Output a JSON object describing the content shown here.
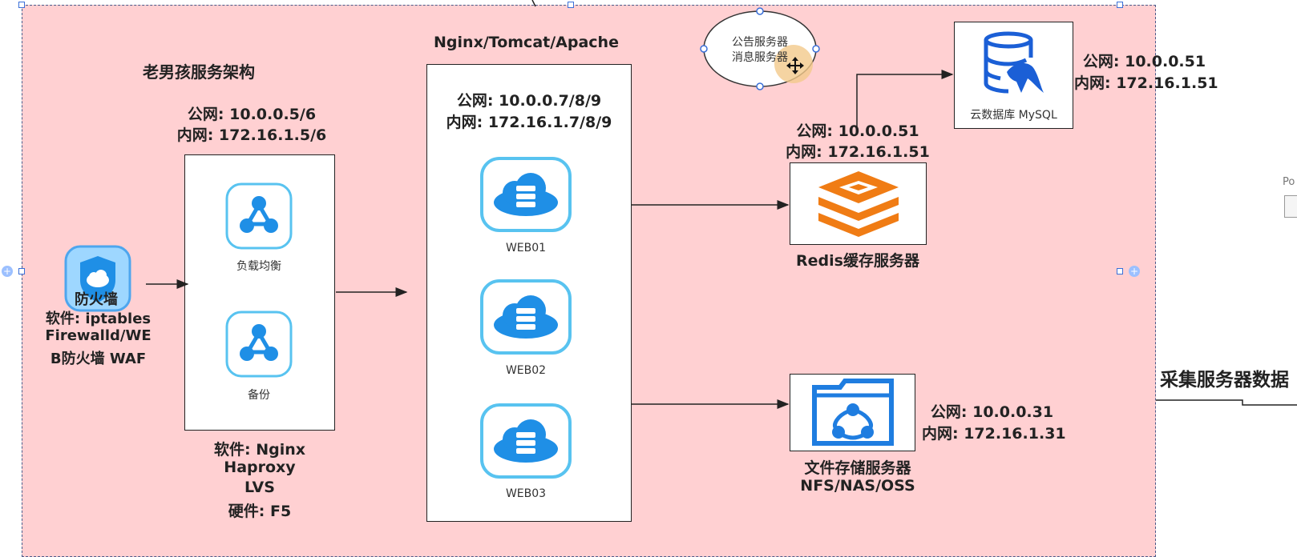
{
  "diagram": {
    "title": "老男孩服务架构",
    "firewall": {
      "label": "防火墙",
      "software_line1": "软件: iptables",
      "software_line2": "Firewalld/WE",
      "software_line3": "B防火墙 WAF"
    },
    "loadbalancer": {
      "public_ip": "公网: 10.0.0.5/6",
      "private_ip": "内网: 172.16.1.5/6",
      "icon1_label": "负载均衡",
      "icon2_label": "备份",
      "software_line1": "软件: Nginx",
      "software_line2": "Haproxy",
      "software_line3": "LVS",
      "hardware": "硬件: F5"
    },
    "web": {
      "header": "Nginx/Tomcat/Apache",
      "public_ip": "公网: 10.0.0.7/8/9",
      "private_ip": "内网: 172.16.1.7/8/9",
      "servers": [
        "WEB01",
        "WEB02",
        "WEB03"
      ]
    },
    "notice": {
      "line1": "公告服务器",
      "line2": "消息服务器"
    },
    "redis": {
      "public_ip": "公网: 10.0.0.51",
      "private_ip": "内网: 172.16.1.51",
      "label": "Redis缓存服务器"
    },
    "mysql": {
      "label": "云数据库 MySQL",
      "public_ip": "公网: 10.0.0.51",
      "private_ip": "内网: 172.16.1.51"
    },
    "nfs": {
      "public_ip": "公网: 10.0.0.31",
      "private_ip": "内网: 172.16.1.31",
      "label_line1": "文件存储服务器",
      "label_line2": "NFS/NAS/OSS"
    },
    "collect": {
      "label": "采集服务器数据"
    },
    "partial_label": "Po"
  },
  "colors": {
    "frame_bg": "#ffd0d2",
    "icon_blue": "#1f8fe6",
    "icon_border": "#58c3f0",
    "redis_orange": "#f07c14",
    "mysql_blue": "#1b5fd6"
  }
}
